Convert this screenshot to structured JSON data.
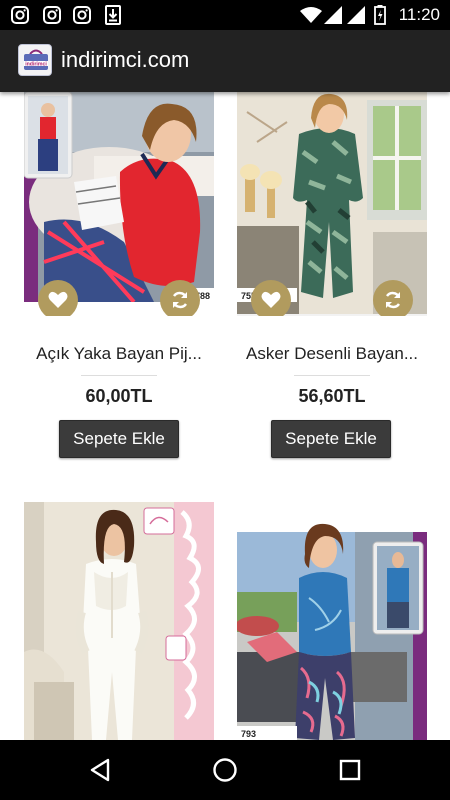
{
  "status_bar": {
    "time": "11:20",
    "left_icons": [
      "instagram-icon",
      "instagram-icon",
      "instagram-icon",
      "download-icon"
    ],
    "right_icons": [
      "wifi-icon",
      "signal-icon",
      "signal-icon",
      "battery-icon"
    ]
  },
  "app_bar": {
    "title": "indirimci.com",
    "logo_text": "indirimci"
  },
  "products": [
    {
      "name": "Açık Yaka Bayan Pij...",
      "price": "60,00TL",
      "button": "Sepete Ekle",
      "image_code": "788"
    },
    {
      "name": "Asker Desenli Bayan...",
      "price": "56,60TL",
      "button": "Sepete Ekle",
      "image_code": "755"
    },
    {
      "name": "",
      "price": "",
      "button": "",
      "image_code": ""
    },
    {
      "name": "",
      "price": "",
      "button": "",
      "image_code": "793"
    }
  ],
  "colors": {
    "accent_gold": "#b19b5e",
    "app_bar": "#222222",
    "cart_button": "#3b3b3b"
  },
  "nav_bar": {
    "icons": [
      "back-icon",
      "home-icon",
      "recents-icon"
    ]
  }
}
